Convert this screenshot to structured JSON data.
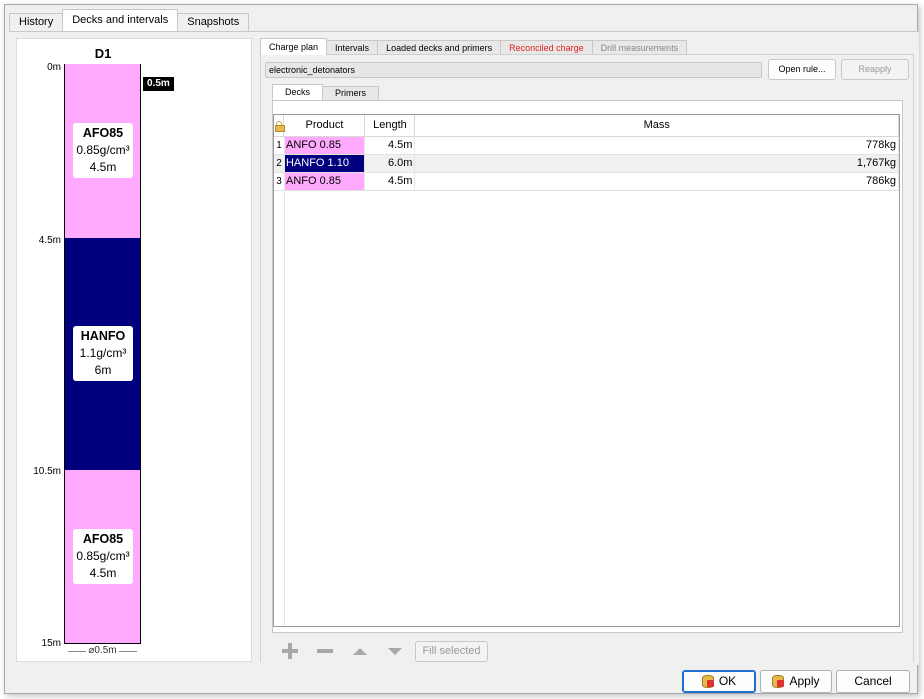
{
  "top_tabs": [
    {
      "label": "History",
      "active": false
    },
    {
      "label": "Decks and intervals",
      "active": true
    },
    {
      "label": "Snapshots",
      "active": false
    }
  ],
  "drill": {
    "hole_name": "D1",
    "collar_badge": "0.5m",
    "diameter": "⌀0.5m",
    "total_depth": 15,
    "depth_ticks": [
      "0m",
      "4.5m",
      "10.5m",
      "15m"
    ],
    "decks": [
      {
        "product": "AFO85",
        "density": "0.85g/cm³",
        "length": "4.5m",
        "from": 0,
        "to": 4.5,
        "color": "#ffaaff"
      },
      {
        "product": "HANFO",
        "density": "1.1g/cm³",
        "length": "6m",
        "from": 4.5,
        "to": 10.5,
        "color": "#00007f"
      },
      {
        "product": "AFO85",
        "density": "0.85g/cm³",
        "length": "4.5m",
        "from": 10.5,
        "to": 15,
        "color": "#ffaaff"
      }
    ]
  },
  "sub_tabs": [
    {
      "label": "Charge plan",
      "state": "active"
    },
    {
      "label": "Intervals",
      "state": "normal"
    },
    {
      "label": "Loaded decks and primers",
      "state": "normal"
    },
    {
      "label": "Reconciled charge",
      "state": "red"
    },
    {
      "label": "Drill measurements",
      "state": "disabled"
    }
  ],
  "charge_plan": {
    "rule_name": "electronic_detonators",
    "open_rule_label": "Open rule...",
    "reapply_label": "Reapply",
    "inner_tabs": [
      {
        "label": "Decks",
        "active": true
      },
      {
        "label": "Primers",
        "active": false
      }
    ],
    "columns": {
      "product": "Product",
      "length": "Length",
      "mass": "Mass"
    },
    "rows": [
      {
        "index": "1",
        "product": "ANFO 0.85",
        "length": "4.5m",
        "mass": "778kg",
        "product_bg": "#ffaaff",
        "product_fg": "#000000"
      },
      {
        "index": "2",
        "product": "HANFO 1.10",
        "length": "6.0m",
        "mass": "1,767kg",
        "product_bg": "#00007f",
        "product_fg": "#ffffff"
      },
      {
        "index": "3",
        "product": "ANFO 0.85",
        "length": "4.5m",
        "mass": "786kg",
        "product_bg": "#ffaaff",
        "product_fg": "#000000"
      }
    ],
    "fill_selected_label": "Fill selected"
  },
  "footer": {
    "ok_label": "OK",
    "apply_label": "Apply",
    "cancel_label": "Cancel"
  }
}
